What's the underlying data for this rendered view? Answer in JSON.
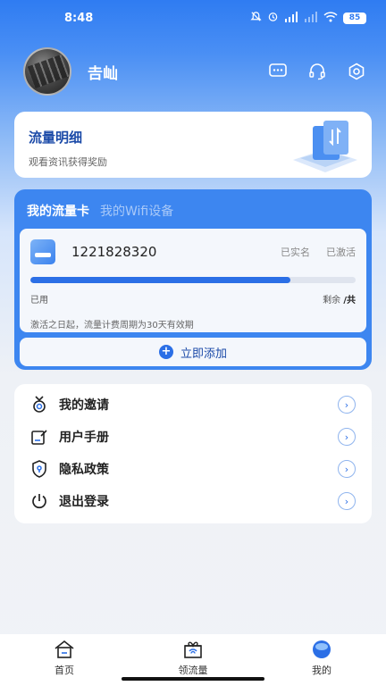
{
  "status_bar": {
    "time": "8:48",
    "battery": "85"
  },
  "profile": {
    "username": "𠮷屾"
  },
  "flow_card": {
    "title": "流量明细",
    "subtitle": "观看资讯获得奖励"
  },
  "sim_panel": {
    "tabs": [
      {
        "label": "我的流量卡"
      },
      {
        "label": "我的Wifi设备"
      }
    ],
    "card": {
      "number": "1221828320",
      "status_real_name": "已实名",
      "status_activated": "已激活",
      "usage_progress": 0.8,
      "used_label": "已用",
      "remain_label": "剩余",
      "remain_total": "/共",
      "note": "激活之日起，流量计费周期为30天有效期"
    },
    "add_label": "立即添加"
  },
  "menu": {
    "items": [
      {
        "label": "我的邀请",
        "icon": "medal-icon"
      },
      {
        "label": "用户手册",
        "icon": "edit-doc-icon"
      },
      {
        "label": "隐私政策",
        "icon": "shield-icon"
      },
      {
        "label": "退出登录",
        "icon": "power-icon"
      }
    ]
  },
  "tabbar": {
    "items": [
      {
        "label": "首页"
      },
      {
        "label": "领流量"
      },
      {
        "label": "我的"
      }
    ]
  },
  "colors": {
    "primary": "#2b6fe6",
    "panel": "#3d86f0",
    "title_blue": "#1b4aa8"
  }
}
